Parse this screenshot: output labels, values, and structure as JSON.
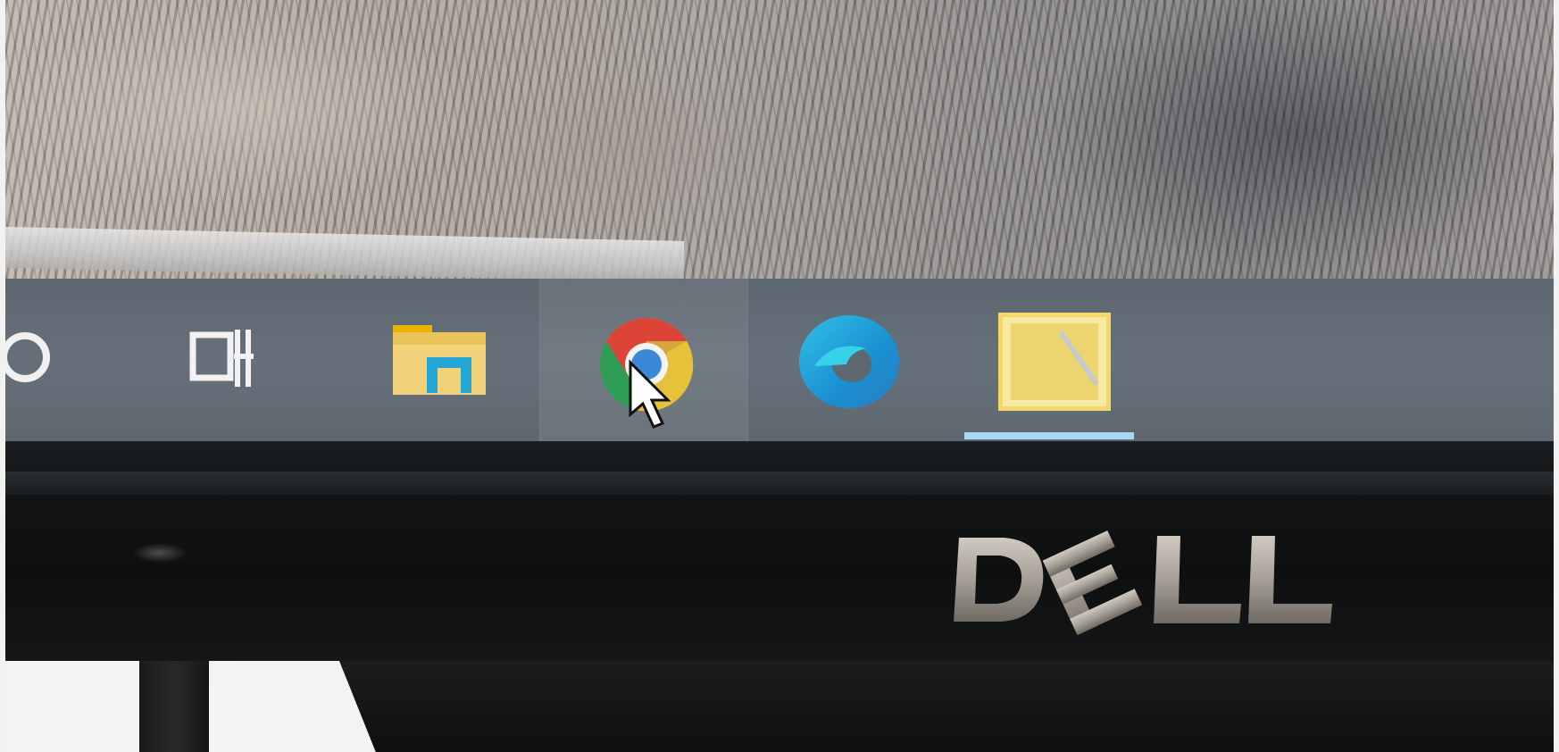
{
  "screen": {
    "taskbar": {
      "items": [
        {
          "name": "search-button",
          "icon": "cortana-circle-icon"
        },
        {
          "name": "task-view-button",
          "icon": "task-view-icon"
        },
        {
          "name": "file-explorer-button",
          "icon": "folder-icon"
        },
        {
          "name": "chrome-button",
          "icon": "chrome-icon",
          "hovered": true
        },
        {
          "name": "edge-button",
          "icon": "edge-icon"
        },
        {
          "name": "sticky-notes-button",
          "icon": "sticky-notes-icon",
          "active": true
        }
      ],
      "colors": {
        "background": "#5f6870",
        "active_indicator": "#a9d6f5"
      }
    },
    "cursor": "arrow-cursor-icon"
  },
  "monitor": {
    "brand_logo": "DELL",
    "bezel_color": "#121416"
  }
}
